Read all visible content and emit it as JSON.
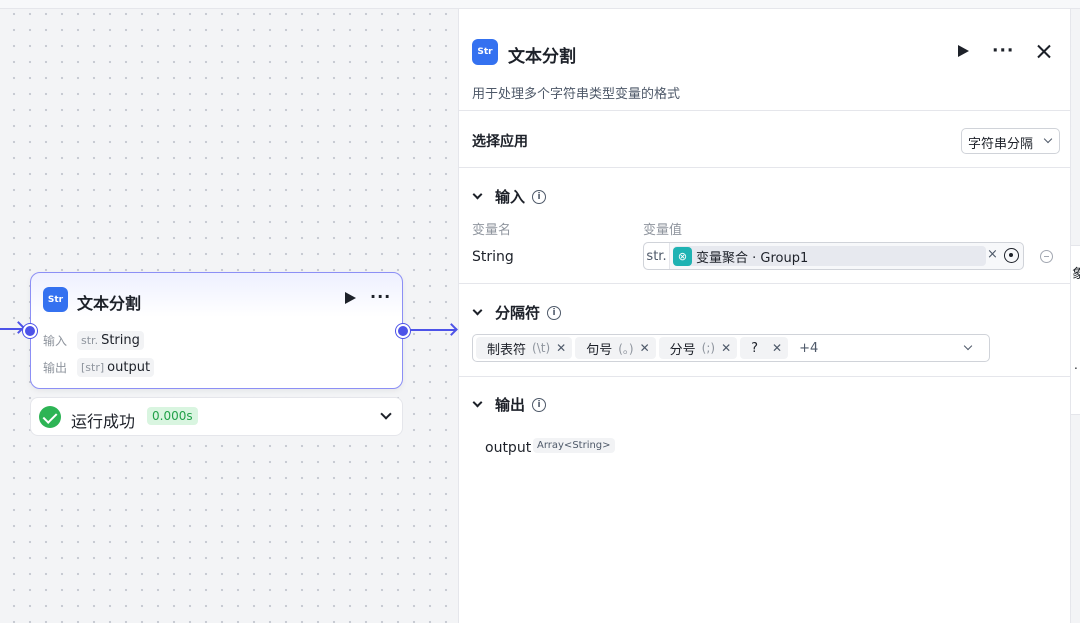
{
  "canvas": {
    "node": {
      "icon": "str-icon",
      "icon_text": "Str",
      "title": "文本分割",
      "more": "···",
      "input_label": "输入",
      "input_type": "str.",
      "input_value": "String",
      "output_label": "输出",
      "output_type": "[str]",
      "output_value": "output"
    },
    "run_status": {
      "text": "运行成功",
      "time": "0.000s"
    }
  },
  "panel": {
    "icon_text": "Str",
    "title": "文本分割",
    "more": "···",
    "description": "用于处理多个字符串类型变量的格式",
    "select_app_label": "选择应用",
    "select_app_value": "字符串分隔",
    "input_section": {
      "title": "输入",
      "col_name": "变量名",
      "col_value": "变量值",
      "var_name": "String",
      "var_type": "str.",
      "ref_icon": "⊗",
      "ref_node": "变量聚合",
      "ref_sep": " · ",
      "ref_group": "Group1",
      "ref_clear": "×"
    },
    "separator_section": {
      "title": "分隔符",
      "chips": [
        {
          "label": "制表符",
          "symbol": "(\\t)"
        },
        {
          "label": "句号",
          "symbol": "(。)"
        },
        {
          "label": "分号",
          "symbol": "(;)"
        },
        {
          "label": "?",
          "symbol": ""
        }
      ],
      "more": "+4"
    },
    "output_section": {
      "title": "输出",
      "name": "output",
      "type": "Array<String>"
    }
  },
  "side_edge": {
    "text": "象",
    "dots": "."
  },
  "colors": {
    "accent": "#4d53e8",
    "node_icon": "#3471f0",
    "success": "#2db455",
    "ref_icon": "#1fb3b3"
  }
}
